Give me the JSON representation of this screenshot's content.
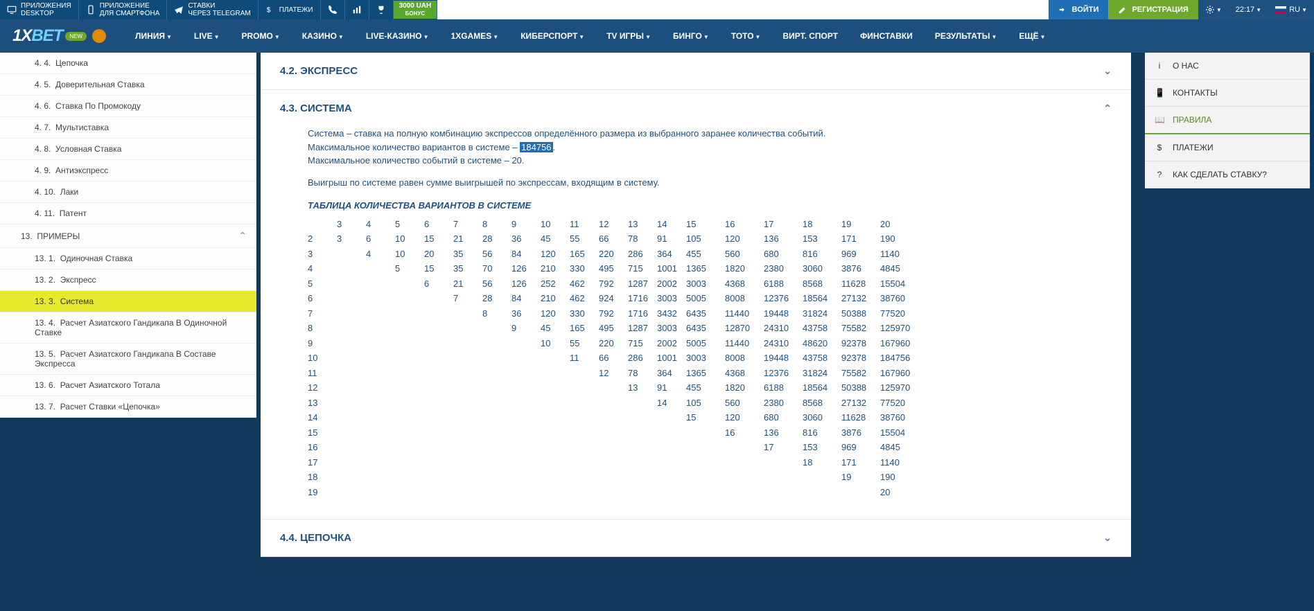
{
  "topbar": {
    "desktop": {
      "l1": "ПРИЛОЖЕНИЯ",
      "l2": "DESKTOP"
    },
    "mobile": {
      "l1": "ПРИЛОЖЕНИЕ",
      "l2": "ДЛЯ СМАРТФОНА"
    },
    "telegram": {
      "l1": "СТАВКИ",
      "l2": "ЧЕРЕЗ TELEGRAM"
    },
    "pay": "ПЛАТЕЖИ",
    "bonus": {
      "l1": "3000 UAH",
      "l2": "БОНУС"
    },
    "login": "ВОЙТИ",
    "reg": "РЕГИСТРАЦИЯ",
    "time": "22:17",
    "lang": "RU"
  },
  "nav": {
    "items": [
      "ЛИНИЯ",
      "LIVE",
      "PROMO",
      "КАЗИНО",
      "LIVE-КАЗИНО",
      "1XGAMES",
      "КИБЕРСПОРТ",
      "TV ИГРЫ",
      "БИНГО",
      "ТОТО",
      "ВИРТ. СПОРТ",
      "ФИНСТАВКИ",
      "РЕЗУЛЬТАТЫ",
      "ЕЩЁ"
    ],
    "badge": "NEW"
  },
  "toc": {
    "pre": [
      {
        "n": "4. 4.",
        "t": "Цепочка"
      },
      {
        "n": "4. 5.",
        "t": "Доверительная Ставка"
      },
      {
        "n": "4. 6.",
        "t": "Ставка По Промокоду"
      },
      {
        "n": "4. 7.",
        "t": "Мультиставка"
      },
      {
        "n": "4. 8.",
        "t": "Условная Ставка"
      },
      {
        "n": "4. 9.",
        "t": "Антиэкспресс"
      },
      {
        "n": "4. 10.",
        "t": "Лаки"
      },
      {
        "n": "4. 11.",
        "t": "Патент"
      }
    ],
    "section": {
      "n": "13.",
      "t": "ПРИМЕРЫ"
    },
    "sub": [
      {
        "n": "13. 1.",
        "t": "Одиночная Ставка"
      },
      {
        "n": "13. 2.",
        "t": "Экспресс"
      },
      {
        "n": "13. 3.",
        "t": "Система",
        "active": true
      },
      {
        "n": "13. 4.",
        "t": "Расчет Азиатского Гандикапа В Одиночной Ставке"
      },
      {
        "n": "13. 5.",
        "t": "Расчет Азиатского Гандикапа В Составе Экспресса"
      },
      {
        "n": "13. 6.",
        "t": "Расчет Азиатского Тотала"
      },
      {
        "n": "13. 7.",
        "t": "Расчет Ставки «Цепочка»"
      }
    ]
  },
  "sections": {
    "s42": "4.2. ЭКСПРЕСС",
    "s43": "4.3. СИСТЕМА",
    "s44": "4.4. ЦЕПОЧКА"
  },
  "body": {
    "p1a": "Система – ставка на полную комбинацию экспрессов определённого размера из выбранного заранее количества событий.",
    "p1b": "Максимальное количество вариантов в системе – ",
    "hl": "184756",
    "p1c": ".",
    "p1d": "Максимальное количество событий в системе – 20.",
    "p2": "Выигрыш по системе равен сумме выигрышей по экспрессам, входящим в систему.",
    "tblTitle": "ТАБЛИЦА КОЛИЧЕСТВА ВАРИАНТОВ В СИСТЕМЕ",
    "head": [
      "",
      "3",
      "4",
      "5",
      "6",
      "7",
      "8",
      "9",
      "10",
      "11",
      "12",
      "13",
      "14",
      "15",
      "16",
      "17",
      "18",
      "19",
      "20"
    ],
    "rows": [
      [
        "2",
        "3",
        "6",
        "10",
        "15",
        "21",
        "28",
        "36",
        "45",
        "55",
        "66",
        "78",
        "91",
        "105",
        "120",
        "136",
        "153",
        "171",
        "190"
      ],
      [
        "3",
        "",
        "4",
        "10",
        "20",
        "35",
        "56",
        "84",
        "120",
        "165",
        "220",
        "286",
        "364",
        "455",
        "560",
        "680",
        "816",
        "969",
        "1140"
      ],
      [
        "4",
        "",
        "",
        "5",
        "15",
        "35",
        "70",
        "126",
        "210",
        "330",
        "495",
        "715",
        "1001",
        "1365",
        "1820",
        "2380",
        "3060",
        "3876",
        "4845"
      ],
      [
        "5",
        "",
        "",
        "",
        "6",
        "21",
        "56",
        "126",
        "252",
        "462",
        "792",
        "1287",
        "2002",
        "3003",
        "4368",
        "6188",
        "8568",
        "11628",
        "15504"
      ],
      [
        "6",
        "",
        "",
        "",
        "",
        "7",
        "28",
        "84",
        "210",
        "462",
        "924",
        "1716",
        "3003",
        "5005",
        "8008",
        "12376",
        "18564",
        "27132",
        "38760"
      ],
      [
        "7",
        "",
        "",
        "",
        "",
        "",
        "8",
        "36",
        "120",
        "330",
        "792",
        "1716",
        "3432",
        "6435",
        "11440",
        "19448",
        "31824",
        "50388",
        "77520"
      ],
      [
        "8",
        "",
        "",
        "",
        "",
        "",
        "",
        "9",
        "45",
        "165",
        "495",
        "1287",
        "3003",
        "6435",
        "12870",
        "24310",
        "43758",
        "75582",
        "125970"
      ],
      [
        "9",
        "",
        "",
        "",
        "",
        "",
        "",
        "",
        "10",
        "55",
        "220",
        "715",
        "2002",
        "5005",
        "11440",
        "24310",
        "48620",
        "92378",
        "167960"
      ],
      [
        "10",
        "",
        "",
        "",
        "",
        "",
        "",
        "",
        "",
        "11",
        "66",
        "286",
        "1001",
        "3003",
        "8008",
        "19448",
        "43758",
        "92378",
        "184756"
      ],
      [
        "11",
        "",
        "",
        "",
        "",
        "",
        "",
        "",
        "",
        "",
        "12",
        "78",
        "364",
        "1365",
        "4368",
        "12376",
        "31824",
        "75582",
        "167960"
      ],
      [
        "12",
        "",
        "",
        "",
        "",
        "",
        "",
        "",
        "",
        "",
        "",
        "13",
        "91",
        "455",
        "1820",
        "6188",
        "18564",
        "50388",
        "125970"
      ],
      [
        "13",
        "",
        "",
        "",
        "",
        "",
        "",
        "",
        "",
        "",
        "",
        "",
        "14",
        "105",
        "560",
        "2380",
        "8568",
        "27132",
        "77520"
      ],
      [
        "14",
        "",
        "",
        "",
        "",
        "",
        "",
        "",
        "",
        "",
        "",
        "",
        "",
        "15",
        "120",
        "680",
        "3060",
        "11628",
        "38760"
      ],
      [
        "15",
        "",
        "",
        "",
        "",
        "",
        "",
        "",
        "",
        "",
        "",
        "",
        "",
        "",
        "16",
        "136",
        "816",
        "3876",
        "15504"
      ],
      [
        "16",
        "",
        "",
        "",
        "",
        "",
        "",
        "",
        "",
        "",
        "",
        "",
        "",
        "",
        "",
        "17",
        "153",
        "969",
        "4845"
      ],
      [
        "17",
        "",
        "",
        "",
        "",
        "",
        "",
        "",
        "",
        "",
        "",
        "",
        "",
        "",
        "",
        "",
        "18",
        "171",
        "1140"
      ],
      [
        "18",
        "",
        "",
        "",
        "",
        "",
        "",
        "",
        "",
        "",
        "",
        "",
        "",
        "",
        "",
        "",
        "",
        "19",
        "190"
      ],
      [
        "19",
        "",
        "",
        "",
        "",
        "",
        "",
        "",
        "",
        "",
        "",
        "",
        "",
        "",
        "",
        "",
        "",
        "",
        "20"
      ]
    ]
  },
  "rnav": [
    {
      "ico": "i",
      "t": "О НАС"
    },
    {
      "ico": "📱",
      "t": "КОНТАКТЫ"
    },
    {
      "ico": "📖",
      "t": "ПРАВИЛА",
      "active": true
    },
    {
      "ico": "$",
      "t": "ПЛАТЕЖИ"
    },
    {
      "ico": "?",
      "t": "КАК СДЕЛАТЬ СТАВКУ?"
    }
  ]
}
